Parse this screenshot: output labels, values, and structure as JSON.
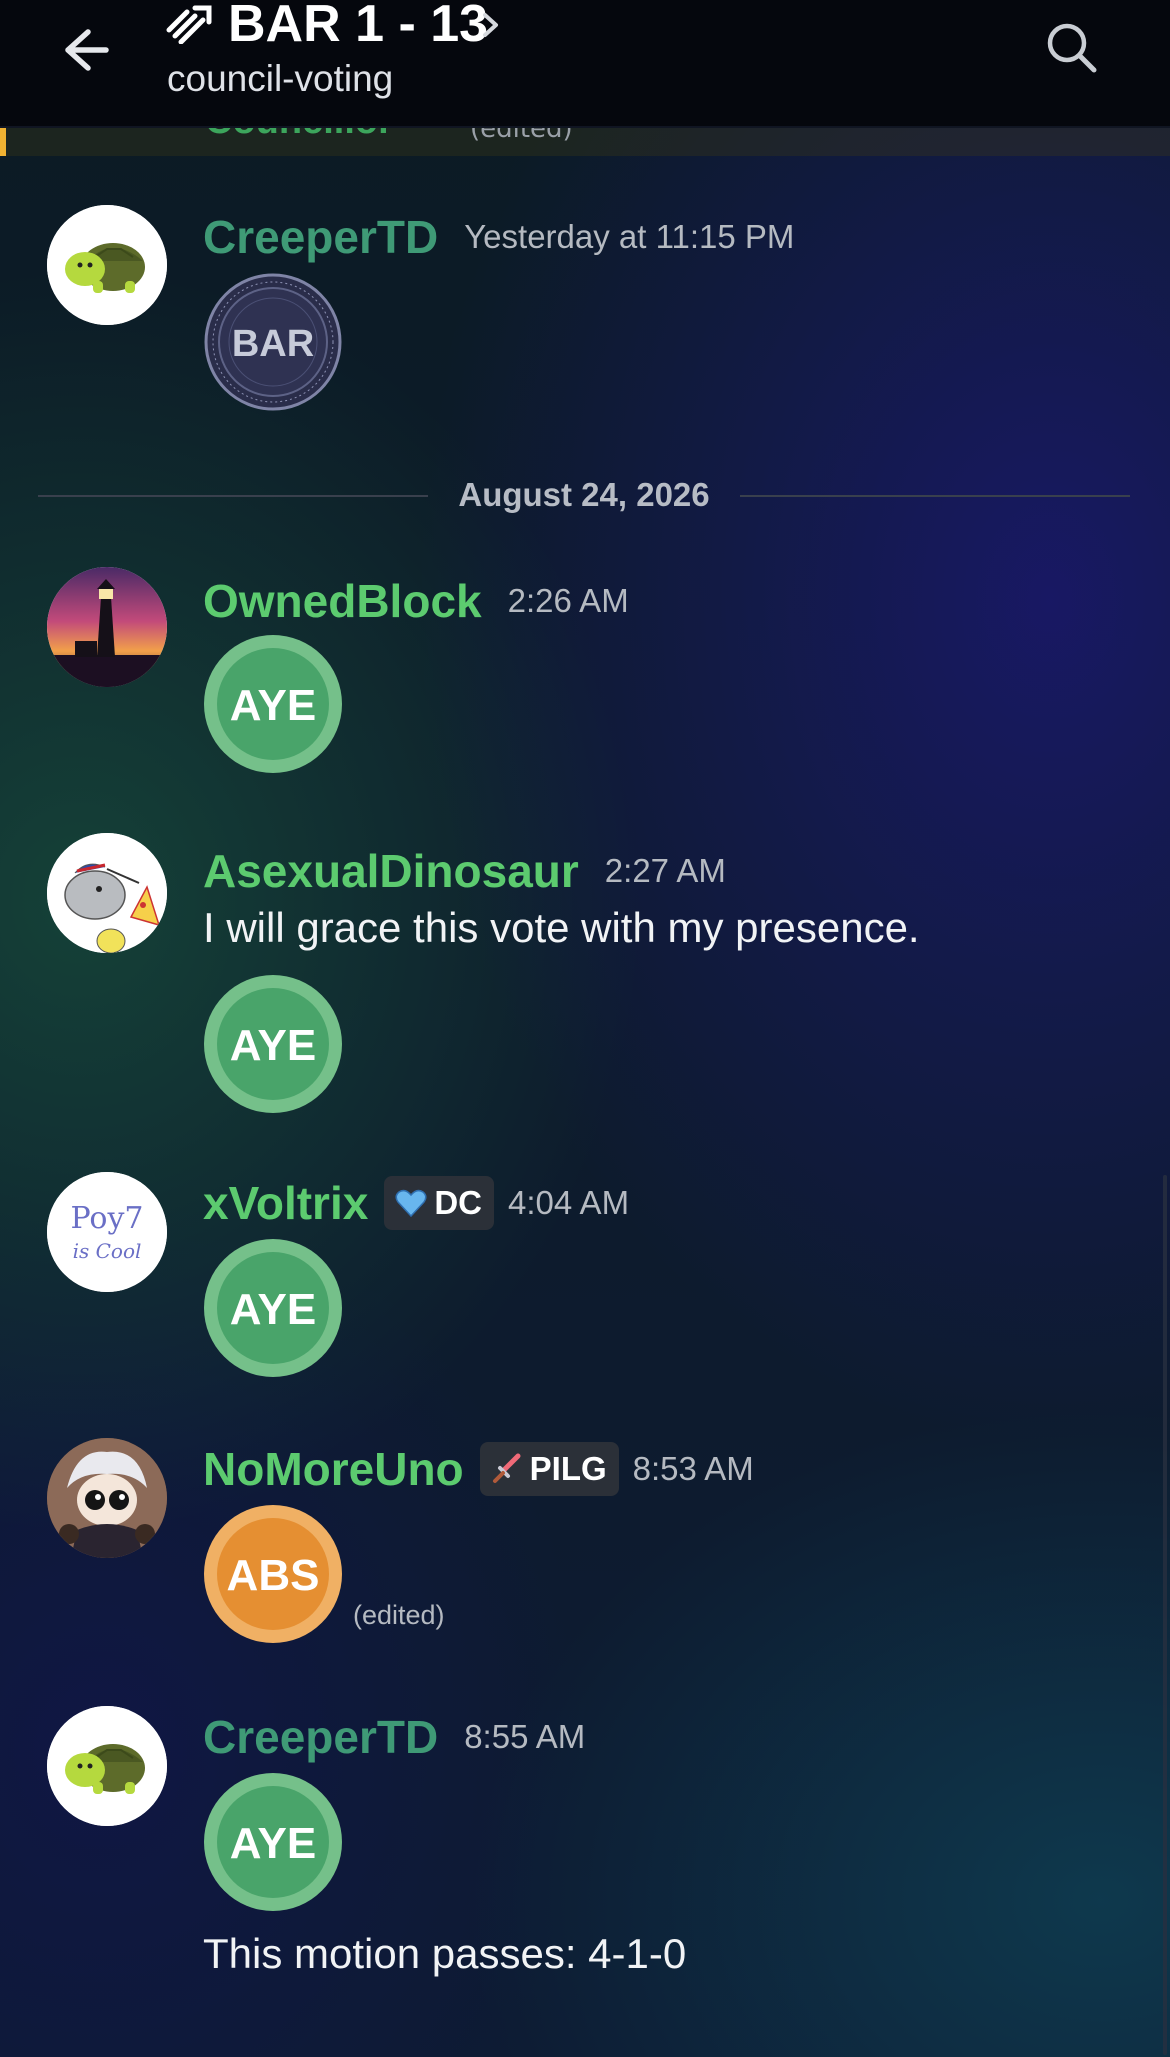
{
  "header": {
    "title": "BAR 1 - 13",
    "channel": "council-voting",
    "icons": [
      "back-arrow-icon",
      "server-icon",
      "chevron-right-icon",
      "search-icon"
    ]
  },
  "previous_message": {
    "author_fragment": "Councillor",
    "edited_label": "(edited)",
    "accent_color": "#f0b232"
  },
  "seal": {
    "text": "BAR",
    "ring_text": "SEAL of the BAR ASSOCIATION of REDMONT",
    "bottom_text": "COMMONWEALTH OF REDMONT"
  },
  "date_divider": "August 24, 2026",
  "messages": [
    {
      "author": "CreeperTD",
      "time": "Yesterday at 11:15 PM",
      "content": "",
      "attachment": "bar-seal-emoji",
      "avatar": "turtle-avatar"
    },
    {
      "author": "OwnedBlock",
      "time": "2:26 AM",
      "content": "",
      "vote": "AYE",
      "avatar": "lighthouse-avatar"
    },
    {
      "author": "AsexualDinosaur",
      "time": "2:27 AM",
      "content": "I will grace this vote with my presence.",
      "vote": "AYE",
      "avatar": "drawn-dinosaur-avatar"
    },
    {
      "author": "xVoltrix",
      "tag": "DC",
      "tag_icon": "blue-heart-icon",
      "time": "4:04 AM",
      "content": "",
      "vote": "AYE",
      "avatar": "poyt-is-cool-avatar",
      "avatar_text": [
        "Poy7",
        "is Cool"
      ]
    },
    {
      "author": "NoMoreUno",
      "tag": "PILG",
      "tag_icon": "sword-icon",
      "time": "8:53 AM",
      "content": "",
      "vote": "ABS",
      "edited": "(edited)",
      "avatar": "anime-character-avatar"
    },
    {
      "author": "CreeperTD",
      "time": "8:55 AM",
      "content": "This motion passes: 4-1-0",
      "vote": "AYE",
      "avatar": "turtle-avatar"
    }
  ],
  "colors": {
    "username_green": "#5ccb6f",
    "username_teal": "#3f9a76",
    "aye_green": "#4aa86a",
    "abs_orange": "#e6953a",
    "header_bg": "#05070d"
  }
}
